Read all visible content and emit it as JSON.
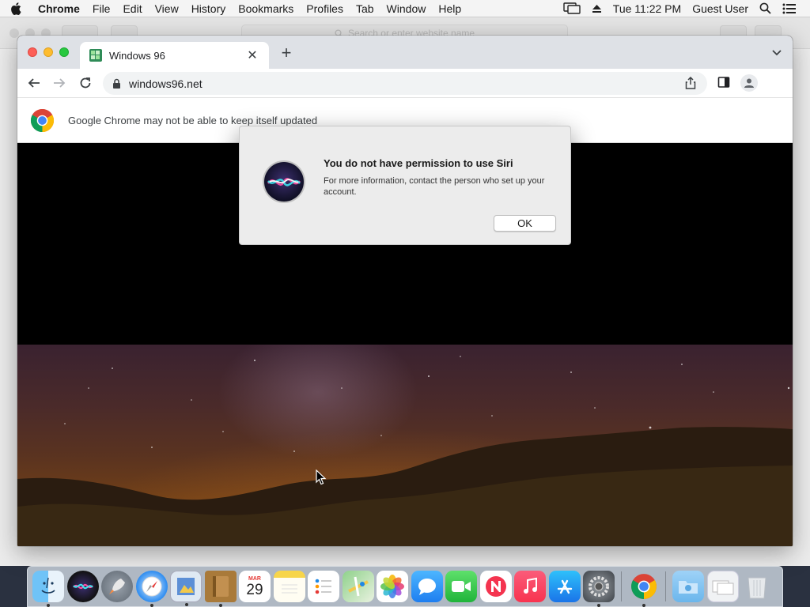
{
  "menubar": {
    "app_name": "Chrome",
    "items": [
      "File",
      "Edit",
      "View",
      "History",
      "Bookmarks",
      "Profiles",
      "Tab",
      "Window",
      "Help"
    ],
    "clock": "Tue 11:22 PM",
    "user": "Guest User"
  },
  "background_window": {
    "address_placeholder": "Search or enter website name"
  },
  "chrome": {
    "tab_title": "Windows 96",
    "url": "windows96.net",
    "infobar_message": "Google Chrome may not be able to keep itself updated"
  },
  "dialog": {
    "title": "You do not have permission to use Siri",
    "message": "For more information, contact the person who set up your account.",
    "ok_label": "OK"
  },
  "dock": {
    "calendar_month": "MAR",
    "calendar_day": "29",
    "apps": [
      "finder",
      "siri",
      "launchpad",
      "safari",
      "mail-scope",
      "notes-brown",
      "calendar",
      "notes",
      "reminders",
      "maps",
      "photos",
      "messages",
      "facetime",
      "news",
      "music",
      "app-store",
      "system-preferences",
      "chrome",
      "folder",
      "downloads",
      "trash"
    ]
  },
  "colors": {
    "close": "#fd5f57",
    "minimize": "#febc2e",
    "zoom": "#28c840",
    "tab_strip": "#dee1e6"
  }
}
